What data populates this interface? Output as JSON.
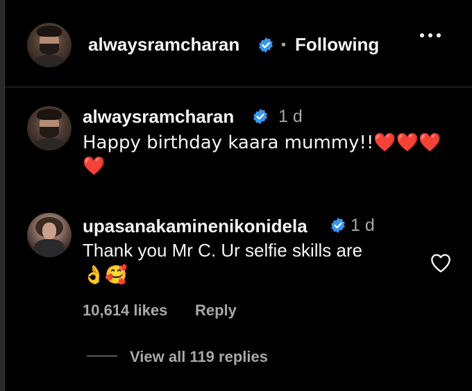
{
  "header": {
    "username": "alwaysramcharan",
    "separator": "•",
    "follow_status": "Following",
    "more_icon": "more-horizontal-icon"
  },
  "comments": [
    {
      "username": "alwaysramcharan",
      "time": "1 d",
      "text_line1": "Happy birthday kaara mummy!!❤️❤️❤️",
      "text_line2": "❤️"
    },
    {
      "username": "upasanakaminenikonidela",
      "time": "1 d",
      "text_line1": "Thank you Mr C. Ur selfie skills are",
      "text_line2": "👌🥰",
      "likes": "10,614 likes",
      "reply_label": "Reply",
      "view_replies": "View all 119 replies"
    }
  ],
  "colors": {
    "background": "#000000",
    "text": "#f5f5f5",
    "secondary": "#a8a8a8",
    "verified": "#3897f0"
  }
}
